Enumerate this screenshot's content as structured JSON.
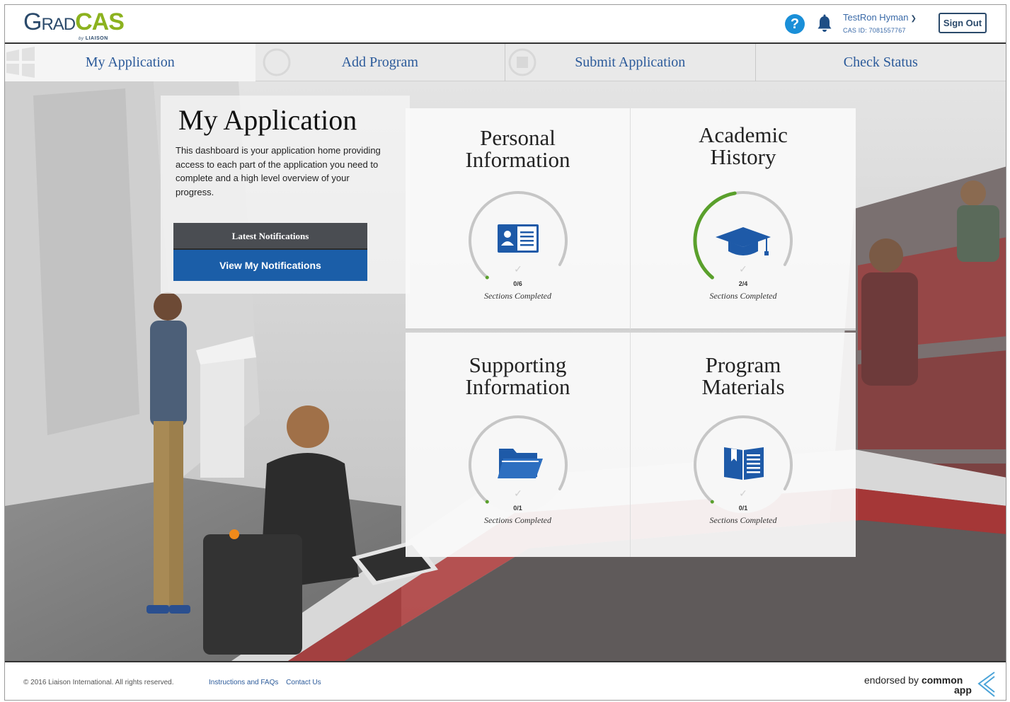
{
  "header": {
    "logo_grad": "Grad",
    "logo_cas": "CAS",
    "logo_by": "by",
    "logo_liaison": "LIAISON",
    "user_name": "TestRon Hyman",
    "cas_id": "CAS ID: 7081557767",
    "sign_out": "Sign Out"
  },
  "nav": {
    "tabs": [
      {
        "label": "My Application"
      },
      {
        "label": "Add Program"
      },
      {
        "label": "Submit Application"
      },
      {
        "label": "Check Status"
      }
    ]
  },
  "intro": {
    "title": "My Application",
    "description": "This dashboard is your application home providing access to each part of the application you need to complete and a high level overview of your progress.",
    "notifications_header": "Latest Notifications",
    "notifications_button": "View My Notifications"
  },
  "cards": [
    {
      "title_line1": "Personal",
      "title_line2": "Information",
      "count": "0/6",
      "completed": 0,
      "total": 6,
      "subtitle": "Sections Completed",
      "icon": "id-card-icon"
    },
    {
      "title_line1": "Academic",
      "title_line2": "History",
      "count": "2/4",
      "completed": 2,
      "total": 4,
      "subtitle": "Sections Completed",
      "icon": "graduation-cap-icon"
    },
    {
      "title_line1": "Supporting",
      "title_line2": "Information",
      "count": "0/1",
      "completed": 0,
      "total": 1,
      "subtitle": "Sections Completed",
      "icon": "folder-icon"
    },
    {
      "title_line1": "Program",
      "title_line2": "Materials",
      "count": "0/1",
      "completed": 0,
      "total": 1,
      "subtitle": "Sections Completed",
      "icon": "book-icon"
    }
  ],
  "footer": {
    "copyright": "© 2016 Liaison International. All rights reserved.",
    "link_instructions": "Instructions and FAQs",
    "link_contact": "Contact Us",
    "endorsed_by": "endorsed by",
    "common": "common",
    "app": "app"
  },
  "colors": {
    "brand_blue": "#2b5a9a",
    "brand_green": "#8cb21f",
    "progress_green": "#5aa02c",
    "button_blue": "#1b5ea8"
  }
}
